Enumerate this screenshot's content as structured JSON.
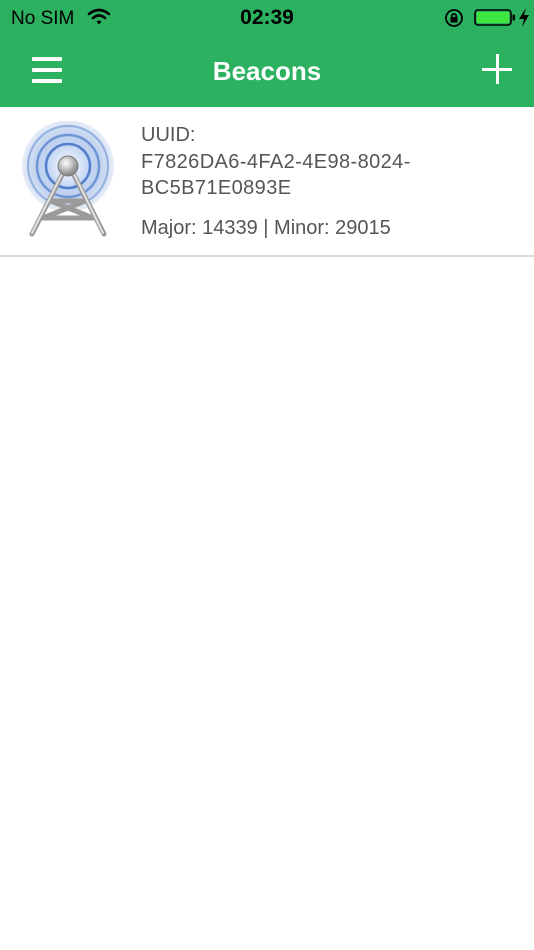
{
  "status_bar": {
    "carrier": "No SIM",
    "time": "02:39",
    "icons": [
      "wifi-icon",
      "orientation-lock-icon",
      "battery-icon",
      "charging-bolt-icon"
    ]
  },
  "navbar": {
    "title": "Beacons",
    "left_icon": "menu-icon",
    "right_icon": "plus-icon",
    "background_color": "#2bb15f"
  },
  "beacons": [
    {
      "icon": "radio-tower-icon",
      "uuid_label": "UUID:",
      "uuid_line1": "F7826DA6-4FA2-4E98-8024-",
      "uuid_line2": "BC5B71E0893E",
      "major_minor": "Major: 14339 | Minor: 29015"
    }
  ]
}
